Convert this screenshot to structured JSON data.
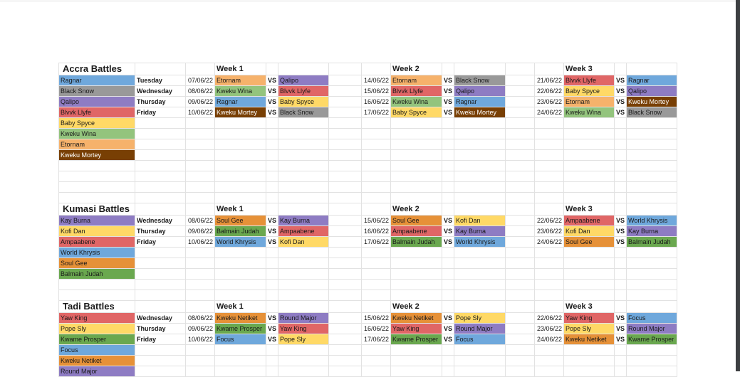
{
  "colors": {
    "blue": "#6fa8dc",
    "gray": "#999999",
    "purple": "#8e7cc3",
    "red": "#e06666",
    "yellow": "#ffd966",
    "lightgreen": "#93c47d",
    "lightorange": "#f6b26b",
    "brown": "#783f04",
    "orange": "#e69138",
    "green": "#6aa84f"
  },
  "sections": [
    {
      "title": "Accra Battles",
      "teams": [
        {
          "name": "Ragnar",
          "color": "blue"
        },
        {
          "name": "Black Snow",
          "color": "gray"
        },
        {
          "name": "Qalipo",
          "color": "purple"
        },
        {
          "name": "Blvvk Llyfe",
          "color": "red"
        },
        {
          "name": "Baby Spyce",
          "color": "yellow"
        },
        {
          "name": "Kweku Wina",
          "color": "lightgreen"
        },
        {
          "name": "Etornam",
          "color": "lightorange"
        },
        {
          "name": "Kweku Mortey",
          "color": "brown"
        }
      ],
      "days": [
        "Tuesday",
        "Wednesday",
        "Thursday",
        "Friday"
      ],
      "weeks": [
        {
          "label": "Week 1",
          "matches": [
            {
              "date": "07/06/22",
              "home": "Etornam",
              "away": "Qalipo"
            },
            {
              "date": "08/06/22",
              "home": "Kweku Wina",
              "away": "Blvvk Llyfe"
            },
            {
              "date": "09/06/22",
              "home": "Ragnar",
              "away": "Baby Spyce"
            },
            {
              "date": "10/06/22",
              "home": "Kweku Mortey",
              "away": "Black Snow"
            }
          ]
        },
        {
          "label": "Week 2",
          "matches": [
            {
              "date": "14/06/22",
              "home": "Etornam",
              "away": "Black Snow"
            },
            {
              "date": "15/06/22",
              "home": "Blvvk Llyfe",
              "away": "Qalipo"
            },
            {
              "date": "16/06/22",
              "home": "Kweku Wina",
              "away": "Ragnar"
            },
            {
              "date": "17/06/22",
              "home": "Baby Spyce",
              "away": "Kweku Mortey"
            }
          ]
        },
        {
          "label": "Week 3",
          "matches": [
            {
              "date": "21/06/22",
              "home": "Blvvk Llyfe",
              "away": "Ragnar"
            },
            {
              "date": "22/06/22",
              "home": "Baby Spyce",
              "away": "Qalipo"
            },
            {
              "date": "23/06/22",
              "home": "Etornam",
              "away": "Kweku Mortey"
            },
            {
              "date": "24/06/22",
              "home": "Kweku Wina",
              "away": "Black Snow"
            }
          ]
        }
      ]
    },
    {
      "title": "Kumasi Battles",
      "teams": [
        {
          "name": "Kay Burna",
          "color": "purple"
        },
        {
          "name": "Kofi Dan",
          "color": "yellow"
        },
        {
          "name": "Ampaabene",
          "color": "red"
        },
        {
          "name": "World Khrysis",
          "color": "blue"
        },
        {
          "name": "Soul Gee",
          "color": "orange"
        },
        {
          "name": "Balmain Judah",
          "color": "green"
        }
      ],
      "days": [
        "Wednesday",
        "Thursday",
        "Friday"
      ],
      "weeks": [
        {
          "label": "Week 1",
          "matches": [
            {
              "date": "08/06/22",
              "home": "Soul Gee",
              "away": "Kay Burna"
            },
            {
              "date": "09/06/22",
              "home": "Balmain Judah",
              "away": "Ampaabene"
            },
            {
              "date": "10/06/22",
              "home": "World Khrysis",
              "away": "Kofi Dan"
            }
          ]
        },
        {
          "label": "Week 2",
          "matches": [
            {
              "date": "15/06/22",
              "home": "Soul Gee",
              "away": "Kofi Dan"
            },
            {
              "date": "16/06/22",
              "home": "Ampaabene",
              "away": "Kay Burna"
            },
            {
              "date": "17/06/22",
              "home": "Balmain Judah",
              "away": "World Khrysis"
            }
          ]
        },
        {
          "label": "Week 3",
          "matches": [
            {
              "date": "22/06/22",
              "home": "Ampaabene",
              "away": "World Khrysis"
            },
            {
              "date": "23/06/22",
              "home": "Kofi Dan",
              "away": "Kay Burna"
            },
            {
              "date": "24/06/22",
              "home": "Soul Gee",
              "away": "Balmain Judah"
            }
          ]
        }
      ]
    },
    {
      "title": "Tadi Battles",
      "teams": [
        {
          "name": "Yaw King",
          "color": "red"
        },
        {
          "name": "Pope Sly",
          "color": "yellow"
        },
        {
          "name": "Kwame Prosper",
          "color": "green"
        },
        {
          "name": "Focus",
          "color": "blue"
        },
        {
          "name": "Kweku Netiket",
          "color": "orange"
        },
        {
          "name": "Round Major",
          "color": "purple"
        }
      ],
      "days": [
        "Wednesday",
        "Thursday",
        "Friday"
      ],
      "weeks": [
        {
          "label": "Week 1",
          "matches": [
            {
              "date": "08/06/22",
              "home": "Kweku Netiket",
              "away": "Round Major"
            },
            {
              "date": "09/06/22",
              "home": "Kwame Prosper",
              "away": "Yaw King"
            },
            {
              "date": "10/06/22",
              "home": "Focus",
              "away": "Pope Sly"
            }
          ]
        },
        {
          "label": "Week 2",
          "matches": [
            {
              "date": "15/06/22",
              "home": "Kweku Netiket",
              "away": "Pope Sly"
            },
            {
              "date": "16/06/22",
              "home": "Yaw King",
              "away": "Round Major"
            },
            {
              "date": "17/06/22",
              "home": "Kwame Prosper",
              "away": "Focus"
            }
          ]
        },
        {
          "label": "Week 3",
          "matches": [
            {
              "date": "22/06/22",
              "home": "Yaw King",
              "away": "Focus"
            },
            {
              "date": "23/06/22",
              "home": "Pope Sly",
              "away": "Round Major"
            },
            {
              "date": "24/06/22",
              "home": "Kweku Netiket",
              "away": "Kwame Prosper"
            }
          ]
        }
      ]
    }
  ],
  "vs_label": "VS"
}
